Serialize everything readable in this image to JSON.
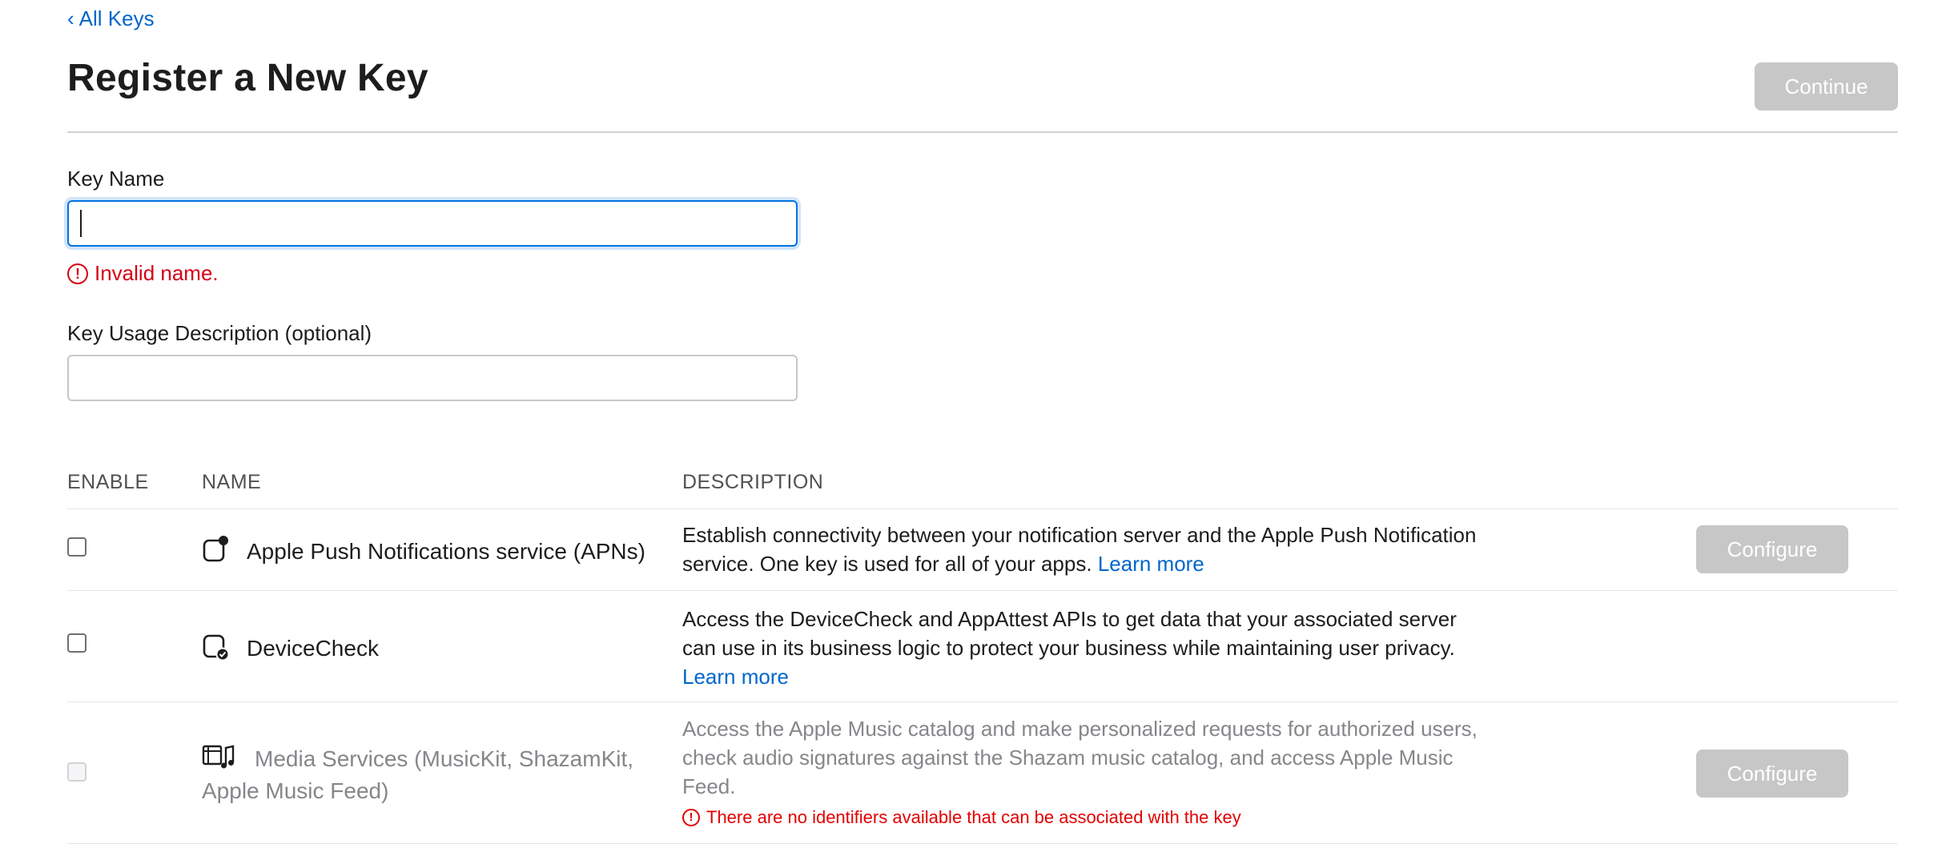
{
  "nav": {
    "back_label": "All Keys",
    "back_chevron": "‹"
  },
  "header": {
    "title": "Register a New Key",
    "continue_label": "Continue"
  },
  "form": {
    "key_name_label": "Key Name",
    "key_name_value": "",
    "key_name_error": "Invalid name.",
    "description_label": "Key Usage Description (optional)",
    "description_value": ""
  },
  "table": {
    "headers": {
      "enable": "ENABLE",
      "name": "NAME",
      "description": "DESCRIPTION"
    },
    "rows": [
      {
        "name": "Apple Push Notifications service (APNs)",
        "icon": "push-notification-icon",
        "description": "Establish connectivity between your notification server and the Apple Push Notification service. One key is used for all of your apps.",
        "learn_more": "Learn more",
        "configure_label": "Configure",
        "enabled": false,
        "disabled": false
      },
      {
        "name": "DeviceCheck",
        "icon": "device-check-icon",
        "description": "Access the DeviceCheck and AppAttest APIs to get data that your associated server can use in its business logic to protect your business while maintaining user privacy.",
        "learn_more": "Learn more",
        "enabled": false,
        "disabled": false
      },
      {
        "name": "Media Services (MusicKit, ShazamKit, Apple Music Feed)",
        "icon": "media-services-icon",
        "description": "Access the Apple Music catalog and make personalized requests for authorized users, check audio signatures against the Shazam music catalog, and access Apple Music Feed.",
        "error": "There are no identifiers available that can be associated with the key",
        "configure_label": "Configure",
        "enabled": false,
        "disabled": true
      }
    ]
  },
  "colors": {
    "link": "#0066cc",
    "error": "#d70015",
    "button_disabled": "#c7c7c7",
    "focus": "#0071e3"
  }
}
